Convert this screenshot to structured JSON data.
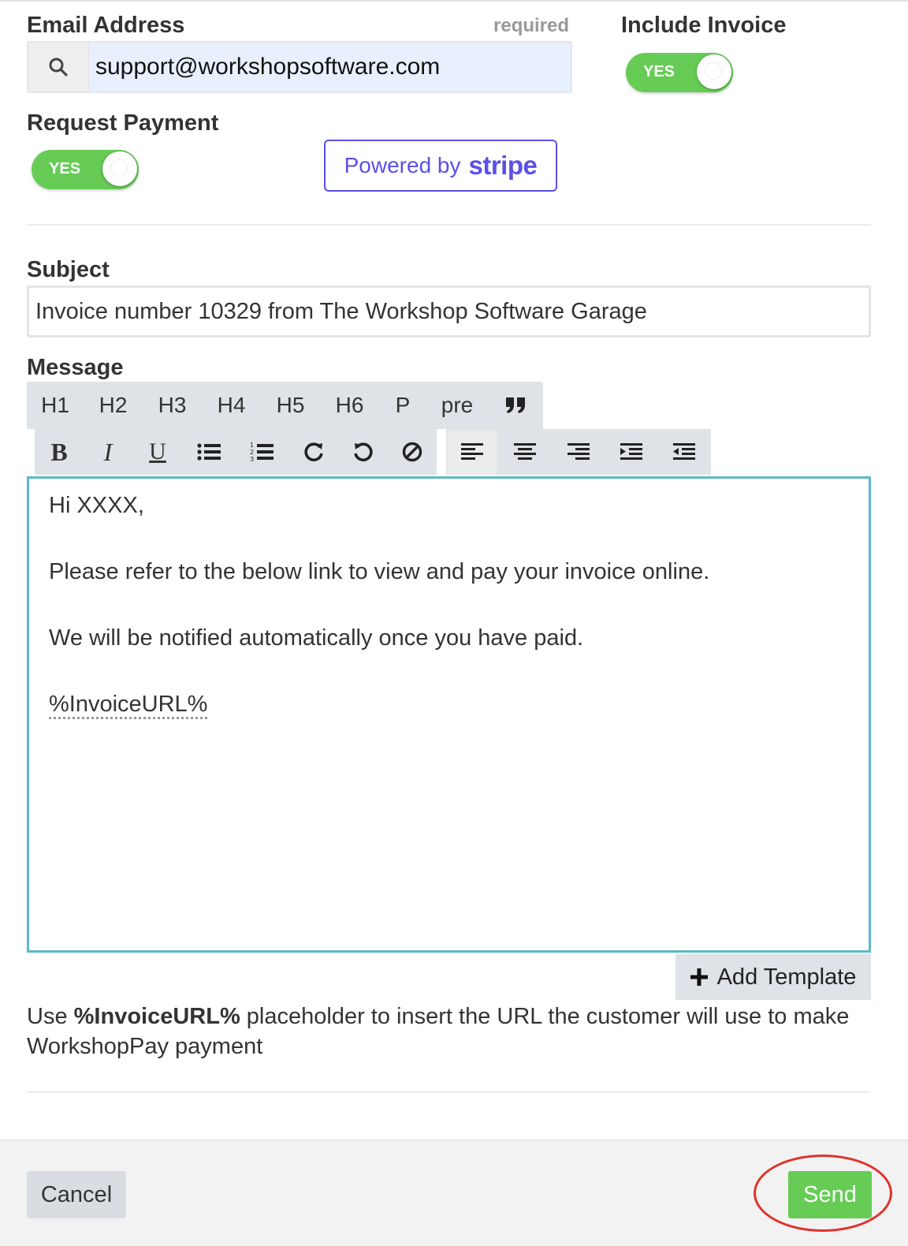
{
  "email": {
    "label": "Email Address",
    "required_text": "required",
    "value": "support@workshopsoftware.com",
    "icon": "search-icon"
  },
  "include_invoice": {
    "label": "Include Invoice",
    "toggle_text": "YES",
    "on": true
  },
  "request_payment": {
    "label": "Request Payment",
    "toggle_text": "YES",
    "on": true
  },
  "stripe": {
    "prefix": "Powered by",
    "brand": "stripe",
    "color": "#5a4fe8"
  },
  "subject": {
    "label": "Subject",
    "value": "Invoice number 10329 from The Workshop Software Garage"
  },
  "message": {
    "label": "Message",
    "toolbar_row1": [
      "H1",
      "H2",
      "H3",
      "H4",
      "H5",
      "H6",
      "P",
      "pre"
    ],
    "lines": [
      "Hi XXXX,",
      "Please refer to the below link to view and pay your invoice online.",
      "We will be notified automatically once you have paid.",
      "%InvoiceURL%"
    ],
    "border_color": "#5bbac9"
  },
  "add_template": {
    "label": "Add Template"
  },
  "help": {
    "before": "Use ",
    "placeholder": "%InvoiceURL%",
    "after": " placeholder to insert the URL the customer will use to make WorkshopPay payment"
  },
  "footer": {
    "cancel_label": "Cancel",
    "send_label": "Send"
  },
  "colors": {
    "accent_green": "#66cc55",
    "annotation_red": "#e0322b"
  }
}
